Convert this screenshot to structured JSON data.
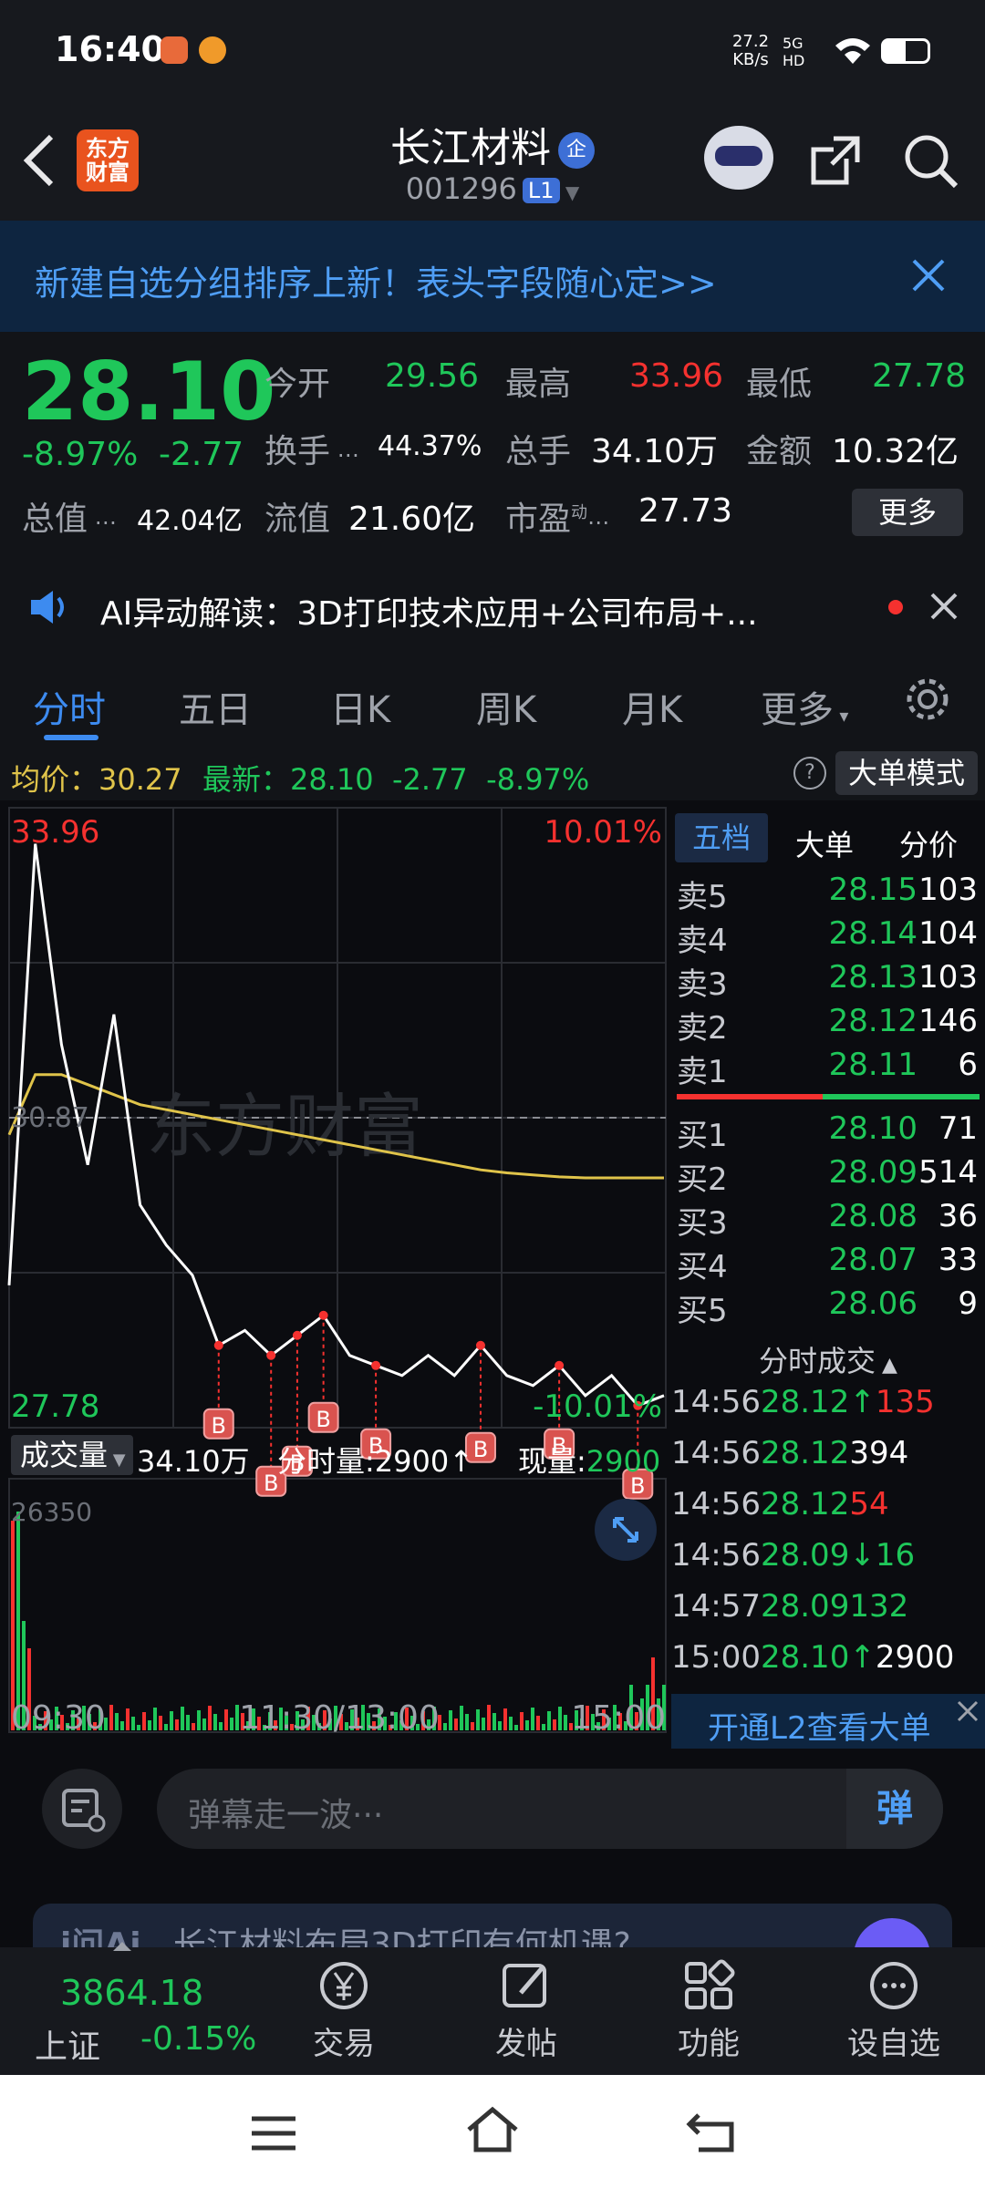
{
  "status": {
    "time": "16:40",
    "net_speed": "27.2",
    "net_unit": "KB/s",
    "signal": "5G HD"
  },
  "header": {
    "logo": "东方\n财富",
    "title": "长江材料",
    "title_badge": "企",
    "code": "001296",
    "level": "L1"
  },
  "banner": {
    "text": "新建自选分组排序上新！表头字段随心定>>"
  },
  "quote": {
    "price": "28.10",
    "pct": "-8.97%",
    "chg": "-2.77",
    "open_label": "今开",
    "open": "29.56",
    "high_label": "最高",
    "high": "33.96",
    "low_label": "最低",
    "low": "27.78",
    "turnover_label": "换手",
    "turnover": "44.37%",
    "vol_label": "总手",
    "vol": "34.10万",
    "amount_label": "金额",
    "amount": "10.32亿",
    "mcap_label": "总值",
    "mcap": "42.04亿",
    "float_label": "流值",
    "float": "21.60亿",
    "pe_label": "市盈",
    "pe_sup": "动",
    "pe": "27.73",
    "more": "更多"
  },
  "ai": {
    "text": "AI异动解读：3D打印技术应用+公司布局+..."
  },
  "tabs": [
    "分时",
    "五日",
    "日K",
    "周K",
    "月K",
    "更多"
  ],
  "info": {
    "avg_label": "均价：",
    "avg": "30.27",
    "last_label": "最新：",
    "last": "28.10",
    "chg": "-2.77",
    "pct": "-8.97%",
    "mode": "大单模式"
  },
  "chart": {
    "top_price": "33.96",
    "top_pct": "10.01%",
    "mid_price": "30.87",
    "bottom_price": "27.78",
    "bottom_pct": "-10.01%",
    "watermark": "东方财富",
    "vol_label": "成交量",
    "vol_total": "34.10万",
    "tick_label": "分时量:",
    "tick_vol": "2900↑",
    "now_label": "现量:",
    "now_vol": "2900",
    "vol_max": "26350",
    "times": [
      "09:30",
      "11:30/13:00",
      "15:00"
    ]
  },
  "chart_data": {
    "type": "line",
    "x_ticks": [
      "09:30",
      "11:30/13:00",
      "15:00"
    ],
    "ylim": [
      27.78,
      33.96
    ],
    "prev_close": 30.87,
    "series": [
      {
        "name": "最新",
        "values": [
          29.2,
          33.6,
          31.6,
          30.4,
          31.9,
          30.0,
          29.6,
          29.3,
          28.6,
          28.75,
          28.5,
          28.7,
          28.9,
          28.5,
          28.4,
          28.3,
          28.5,
          28.3,
          28.6,
          28.3,
          28.2,
          28.4,
          28.1,
          28.3,
          28.0,
          28.1
        ]
      },
      {
        "name": "均价",
        "values": [
          30.7,
          31.3,
          31.3,
          31.2,
          31.1,
          31.0,
          30.95,
          30.9,
          30.85,
          30.8,
          30.75,
          30.7,
          30.65,
          30.6,
          30.55,
          30.5,
          30.45,
          30.4,
          30.35,
          30.32,
          30.3,
          30.28,
          30.27,
          30.27,
          30.27,
          30.27
        ]
      }
    ]
  },
  "book": {
    "tabs": [
      "五档",
      "大单",
      "分价"
    ],
    "asks": [
      {
        "n": "卖5",
        "p": "28.15",
        "v": "103"
      },
      {
        "n": "卖4",
        "p": "28.14",
        "v": "104"
      },
      {
        "n": "卖3",
        "p": "28.13",
        "v": "103"
      },
      {
        "n": "卖2",
        "p": "28.12",
        "v": "146"
      },
      {
        "n": "卖1",
        "p": "28.11",
        "v": "6"
      }
    ],
    "bids": [
      {
        "n": "买1",
        "p": "28.10",
        "v": "71"
      },
      {
        "n": "买2",
        "p": "28.09",
        "v": "514"
      },
      {
        "n": "买3",
        "p": "28.08",
        "v": "36"
      },
      {
        "n": "买4",
        "p": "28.07",
        "v": "33"
      },
      {
        "n": "买5",
        "p": "28.06",
        "v": "9"
      }
    ],
    "trades_title": "分时成交",
    "trades": [
      {
        "t": "14:56",
        "p": "28.12↑",
        "v": "135"
      },
      {
        "t": "14:56",
        "p": "28.12",
        "v": "394"
      },
      {
        "t": "14:56",
        "p": "28.12",
        "v": "54"
      },
      {
        "t": "14:56",
        "p": "28.09↓",
        "v": "16"
      },
      {
        "t": "14:57",
        "p": "28.09",
        "v": "132"
      },
      {
        "t": "15:00",
        "p": "28.10↑",
        "v": "2900"
      }
    ],
    "l2": "开通L2查看大单"
  },
  "comment": {
    "placeholder": "弹幕走一波···",
    "btn": "弹",
    "peek": "长江材料布局3D打印有何机遇?"
  },
  "bottom": {
    "index_val": "3864.18",
    "index_name": "上证",
    "index_pct": "-0.15%",
    "items": [
      "交易",
      "发帖",
      "功能",
      "设自选"
    ]
  }
}
